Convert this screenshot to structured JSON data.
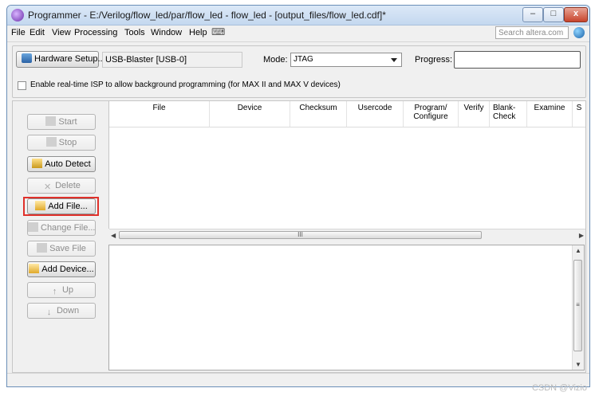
{
  "window": {
    "title": "Programmer - E:/Verilog/flow_led/par/flow_led - flow_led - [output_files/flow_led.cdf]*",
    "minimize": "–",
    "maximize": "□",
    "close": "x"
  },
  "menu": {
    "items": [
      "File",
      "Edit",
      "View",
      "Processing",
      "Tools",
      "Window",
      "Help"
    ],
    "search_placeholder": "Search altera.com"
  },
  "hardware": {
    "setup_button": "Hardware Setup...",
    "device": "USB-Blaster [USB-0]",
    "mode_label": "Mode:",
    "mode_value": "JTAG",
    "progress_label": "Progress:",
    "isp_label": "Enable real-time ISP to allow background programming (for MAX II and MAX V devices)",
    "isp_checked": false
  },
  "sidebar": {
    "start": "Start",
    "stop": "Stop",
    "auto_detect": "Auto Detect",
    "delete": "Delete",
    "add_file": "Add File...",
    "change_file": "Change File...",
    "save_file": "Save File",
    "add_device": "Add Device...",
    "up": "Up",
    "down": "Down"
  },
  "table": {
    "columns": [
      {
        "l1": "File",
        "l2": ""
      },
      {
        "l1": "Device",
        "l2": ""
      },
      {
        "l1": "Checksum",
        "l2": ""
      },
      {
        "l1": "Usercode",
        "l2": ""
      },
      {
        "l1": "Program/",
        "l2": "Configure"
      },
      {
        "l1": "Verify",
        "l2": ""
      },
      {
        "l1": "Blank-",
        "l2": "Check"
      },
      {
        "l1": "Examine",
        "l2": ""
      },
      {
        "l1": "S",
        "l2": ""
      }
    ],
    "hscroll_grip": "III",
    "vscroll_grip": "≡"
  },
  "watermark": "CSDN @Vizio",
  "colors": {
    "highlight": "#e0312b",
    "title_bar": "#c4d8ef"
  }
}
